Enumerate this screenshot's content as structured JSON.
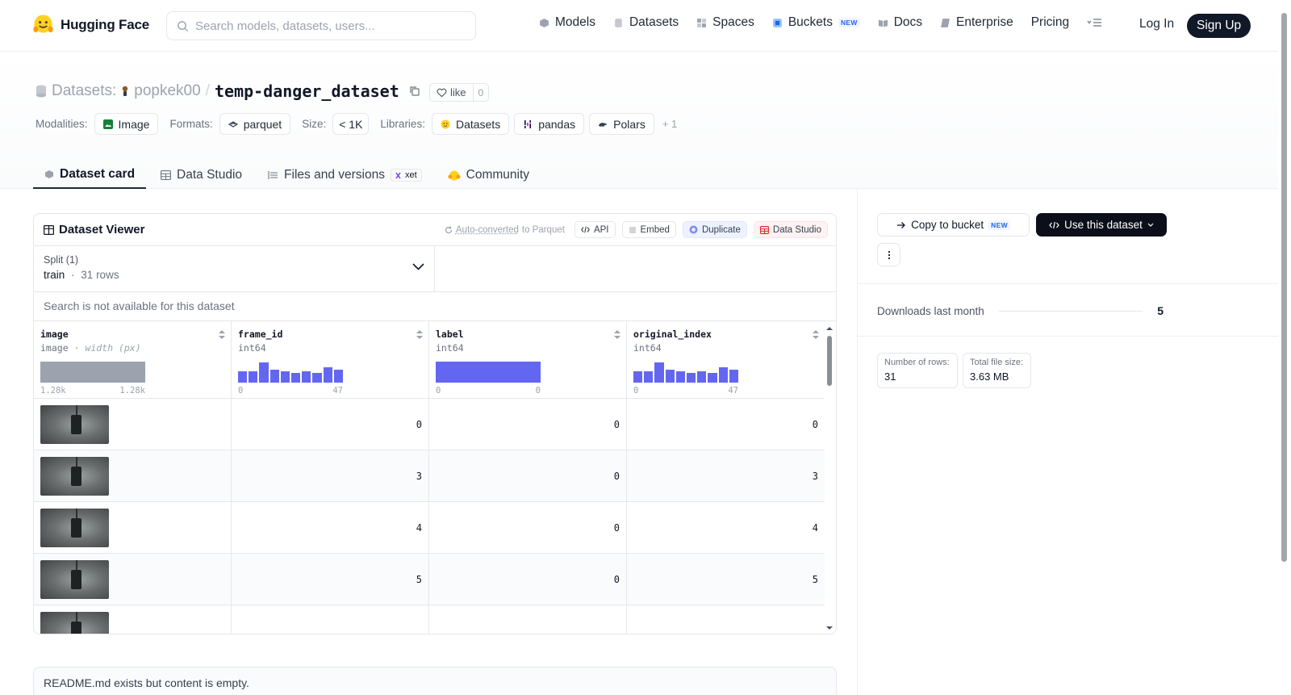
{
  "nav": {
    "brand": "Hugging Face",
    "search_placeholder": "Search models, datasets, users...",
    "items": [
      {
        "label": "Models",
        "icon": "models-icon"
      },
      {
        "label": "Datasets",
        "icon": "datasets-icon"
      },
      {
        "label": "Spaces",
        "icon": "spaces-icon"
      },
      {
        "label": "Buckets",
        "icon": "buckets-icon",
        "badge": "NEW"
      },
      {
        "label": "Docs",
        "icon": "docs-icon"
      },
      {
        "label": "Enterprise",
        "icon": "enterprise-icon"
      },
      {
        "label": "Pricing"
      }
    ],
    "login": "Log In",
    "signup": "Sign Up"
  },
  "header": {
    "section_label": "Datasets:",
    "owner": "popkek00",
    "slash": "/",
    "dataset_name": "temp-danger_dataset",
    "like_label": "like",
    "like_count": "0",
    "modalities_label": "Modalities:",
    "modality": "Image",
    "formats_label": "Formats:",
    "format": "parquet",
    "size_label": "Size:",
    "size": "< 1K",
    "libraries_label": "Libraries:",
    "libraries": [
      "Datasets",
      "pandas",
      "Polars"
    ],
    "more_libraries": "+ 1"
  },
  "tabs": [
    {
      "label": "Dataset card",
      "active": true
    },
    {
      "label": "Data Studio"
    },
    {
      "label": "Files and versions",
      "badge": "xet"
    },
    {
      "label": "Community"
    }
  ],
  "viewer": {
    "title": "Dataset Viewer",
    "auto_converted_pre": "Auto-converted",
    "auto_converted_post": "to Parquet",
    "api": "API",
    "embed": "Embed",
    "duplicate": "Duplicate",
    "data_studio": "Data Studio",
    "split_label": "Split (1)",
    "split_name": "train",
    "split_sep": "·",
    "split_rows": "31 rows",
    "search_na": "Search is not available for this dataset",
    "columns": [
      {
        "name": "image",
        "type": "image",
        "subtype": "· width (px)",
        "min": "1.28k",
        "max": "1.28k"
      },
      {
        "name": "frame_id",
        "type": "int64",
        "min": "0",
        "max": "47"
      },
      {
        "name": "label",
        "type": "int64",
        "min": "0",
        "max": "0"
      },
      {
        "name": "original_index",
        "type": "int64",
        "min": "0",
        "max": "47"
      }
    ],
    "histograms": {
      "frame_id": [
        0.55,
        0.55,
        0.95,
        0.6,
        0.55,
        0.45,
        0.55,
        0.45,
        0.75,
        0.6
      ],
      "original_index": [
        0.55,
        0.55,
        0.95,
        0.6,
        0.55,
        0.45,
        0.55,
        0.45,
        0.75,
        0.6
      ]
    },
    "rows": [
      {
        "frame_id": "0",
        "label": "0",
        "original_index": "0"
      },
      {
        "frame_id": "3",
        "label": "0",
        "original_index": "3"
      },
      {
        "frame_id": "4",
        "label": "0",
        "original_index": "4"
      },
      {
        "frame_id": "5",
        "label": "0",
        "original_index": "5"
      },
      {
        "frame_id": "",
        "label": "",
        "original_index": ""
      }
    ]
  },
  "readme": "README.md exists but content is empty.",
  "sidebar": {
    "copy_to_bucket": "Copy to bucket",
    "copy_badge": "NEW",
    "use_dataset": "Use this dataset",
    "downloads_label": "Downloads last month",
    "downloads": "5",
    "rows_label": "Number of rows:",
    "rows_value": "31",
    "filesize_label": "Total file size:",
    "filesize_value": "3.63 MB"
  },
  "colors": {
    "histogram": "#6366f1",
    "primary_dark": "#0b0f19",
    "brand_yellow": "#FFD21E"
  }
}
